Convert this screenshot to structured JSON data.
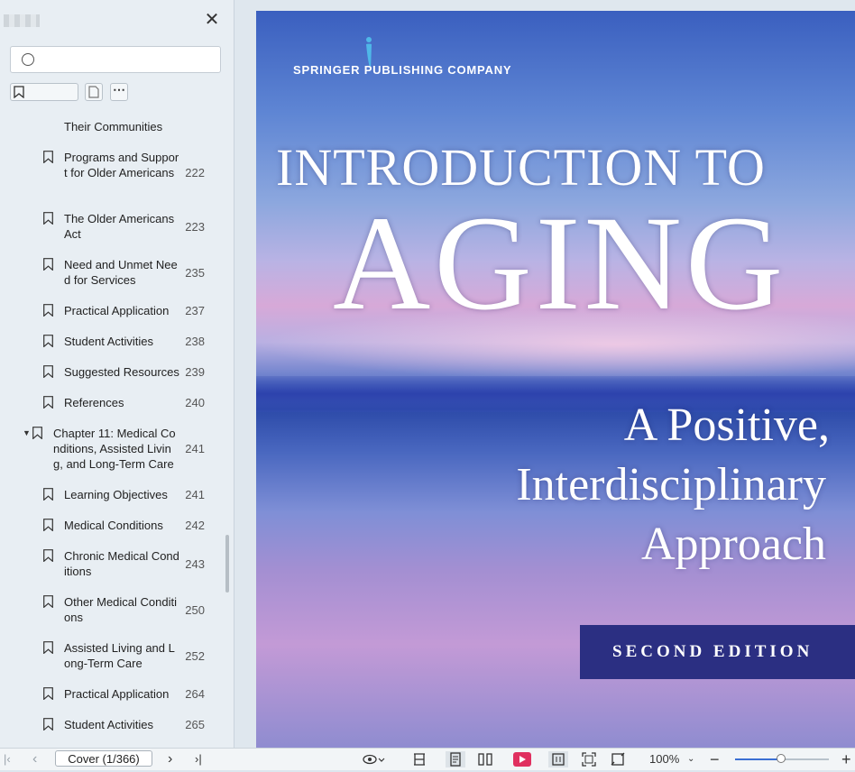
{
  "sidebar": {
    "search_placeholder": "",
    "bookmarks": [
      {
        "label": "Their Communities",
        "page": "",
        "level": 2
      },
      {
        "label": "Programs and Support for Older Americans",
        "page": "222",
        "level": 2
      },
      {
        "label": "The Older Americans Act",
        "page": "223",
        "level": 2
      },
      {
        "label": "Need and Unmet Need for Services",
        "page": "235",
        "level": 2
      },
      {
        "label": "Practical Application",
        "page": "237",
        "level": 2
      },
      {
        "label": "Student Activities",
        "page": "238",
        "level": 2
      },
      {
        "label": "Suggested Resources",
        "page": "239",
        "level": 2
      },
      {
        "label": "References",
        "page": "240",
        "level": 2
      },
      {
        "label": "Chapter 11: Medical Conditions, Assisted Living, and Long-Term Care",
        "page": "241",
        "level": 1
      },
      {
        "label": "Learning Objectives",
        "page": "241",
        "level": 2
      },
      {
        "label": "Medical Conditions",
        "page": "242",
        "level": 2
      },
      {
        "label": "Chronic Medical Conditions",
        "page": "243",
        "level": 2
      },
      {
        "label": "Other Medical Conditions",
        "page": "250",
        "level": 2
      },
      {
        "label": "Assisted Living and Long-Term Care",
        "page": "252",
        "level": 2
      },
      {
        "label": "Practical Application",
        "page": "264",
        "level": 2
      },
      {
        "label": "Student Activities",
        "page": "265",
        "level": 2
      }
    ]
  },
  "cover": {
    "publisher": "SPRINGER PUBLISHING COMPANY",
    "title_line1": "INTRODUCTION TO",
    "title_line2": "AGING",
    "subtitle_line1": "A Positive,",
    "subtitle_line2": "Interdisciplinary",
    "subtitle_line3": "Approach",
    "edition": "SECOND EDITION"
  },
  "bottombar": {
    "page_indicator": "Cover (1/366)",
    "zoom": "100%",
    "zoom_level": 0.5
  }
}
